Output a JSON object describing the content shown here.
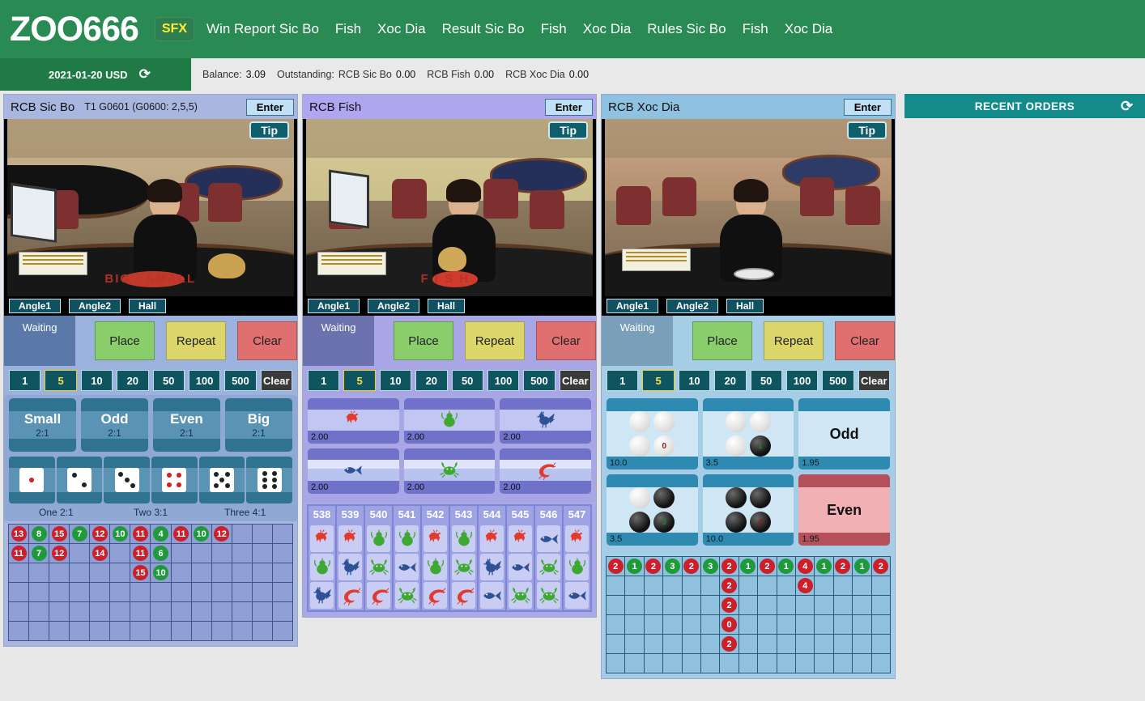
{
  "brand": "ZOO666",
  "nav": {
    "sfx": "SFX",
    "items": [
      "Win Report Sic Bo",
      "Fish",
      "Xoc Dia",
      "Result Sic Bo",
      "Fish",
      "Xoc Dia",
      "Rules Sic Bo",
      "Fish",
      "Xoc Dia"
    ]
  },
  "infobar": {
    "date": "2021-01-20 USD",
    "refresh_icon": "refresh-icon",
    "balance_label": "Balance:",
    "balance_value": "3.09",
    "outstanding_label": "Outstanding:",
    "outstanding": [
      {
        "label": "RCB Sic Bo",
        "value": "0.00"
      },
      {
        "label": "RCB Fish",
        "value": "0.00"
      },
      {
        "label": "RCB Xoc Dia",
        "value": "0.00"
      }
    ]
  },
  "common": {
    "enter": "Enter",
    "tip": "Tip",
    "angles": [
      "Angle1",
      "Angle2",
      "Hall"
    ],
    "status": "Waiting",
    "actions": {
      "place": "Place",
      "repeat": "Repeat",
      "clear": "Clear"
    },
    "chips": [
      "1",
      "5",
      "10",
      "20",
      "50",
      "100",
      "500"
    ],
    "chip_clear": "Clear",
    "chip_selected": "5"
  },
  "sicbo": {
    "title": "RCB Sic Bo",
    "round": "T1 G0601 (G0600: 2,5,5)",
    "bets": [
      {
        "name": "Small",
        "odds": "2:1"
      },
      {
        "name": "Odd",
        "odds": "2:1"
      },
      {
        "name": "Even",
        "odds": "2:1"
      },
      {
        "name": "Big",
        "odds": "2:1"
      }
    ],
    "dice": [
      {
        "pips": 1,
        "color": "red"
      },
      {
        "pips": 2,
        "color": "black"
      },
      {
        "pips": 3,
        "color": "black"
      },
      {
        "pips": 4,
        "color": "red"
      },
      {
        "pips": 5,
        "color": "black"
      },
      {
        "pips": 6,
        "color": "black"
      }
    ],
    "dice_legend": [
      "One  2:1",
      "Two  3:1",
      "Three  4:1"
    ],
    "history_cols": 14,
    "history_rows": 6,
    "history": [
      [
        {
          "v": "13",
          "c": "red"
        },
        {
          "v": "8",
          "c": "green"
        },
        {
          "v": "15",
          "c": "red"
        },
        {
          "v": "7",
          "c": "green"
        },
        {
          "v": "12",
          "c": "red"
        },
        {
          "v": "10",
          "c": "green"
        },
        {
          "v": "11",
          "c": "red"
        },
        {
          "v": "4",
          "c": "green"
        },
        {
          "v": "11",
          "c": "red"
        },
        {
          "v": "10",
          "c": "green"
        },
        {
          "v": "12",
          "c": "red"
        },
        null,
        null,
        null
      ],
      [
        {
          "v": "11",
          "c": "red"
        },
        {
          "v": "7",
          "c": "green"
        },
        {
          "v": "12",
          "c": "red"
        },
        null,
        {
          "v": "14",
          "c": "red"
        },
        null,
        {
          "v": "11",
          "c": "red"
        },
        {
          "v": "6",
          "c": "green"
        },
        null,
        null,
        null,
        null,
        null,
        null
      ],
      [
        null,
        null,
        null,
        null,
        null,
        null,
        {
          "v": "15",
          "c": "red"
        },
        {
          "v": "10",
          "c": "green"
        },
        null,
        null,
        null,
        null,
        null,
        null
      ],
      [
        null,
        null,
        null,
        null,
        null,
        null,
        null,
        null,
        null,
        null,
        null,
        null,
        null,
        null
      ],
      [
        null,
        null,
        null,
        null,
        null,
        null,
        null,
        null,
        null,
        null,
        null,
        null,
        null,
        null
      ],
      [
        null,
        null,
        null,
        null,
        null,
        null,
        null,
        null,
        null,
        null,
        null,
        null,
        null,
        null
      ]
    ]
  },
  "fish": {
    "title": "RCB Fish",
    "bets": [
      {
        "animal": "deer",
        "payout": "2.00",
        "water": false
      },
      {
        "animal": "gourd",
        "payout": "2.00",
        "water": false
      },
      {
        "animal": "rooster",
        "payout": "2.00",
        "water": false
      },
      {
        "animal": "fish",
        "payout": "2.00",
        "water": true
      },
      {
        "animal": "crab",
        "payout": "2.00",
        "water": true
      },
      {
        "animal": "shrimp",
        "payout": "2.00",
        "water": true
      }
    ],
    "history_numbers": [
      "538",
      "539",
      "540",
      "541",
      "542",
      "543",
      "544",
      "545",
      "546",
      "547"
    ],
    "history": [
      [
        "deer",
        "gourd",
        "rooster"
      ],
      [
        "deer",
        "rooster",
        "shrimp"
      ],
      [
        "gourd",
        "crab",
        "shrimp"
      ],
      [
        "gourd",
        "fish",
        "crab"
      ],
      [
        "deer",
        "gourd",
        "shrimp"
      ],
      [
        "gourd",
        "crab",
        "shrimp"
      ],
      [
        "deer",
        "rooster",
        "fish"
      ],
      [
        "deer",
        "fish",
        "crab"
      ],
      [
        "fish",
        "crab",
        "crab"
      ],
      [
        "deer",
        "gourd",
        "fish"
      ]
    ]
  },
  "xocdia": {
    "title": "RCB Xoc Dia",
    "bets": [
      {
        "kind": "beads",
        "beads": [
          "w",
          "w",
          "w",
          "w"
        ],
        "mark": "0",
        "payout": "10.0"
      },
      {
        "kind": "beads",
        "beads": [
          "w",
          "w",
          "w",
          "b"
        ],
        "mark": "1",
        "payout": "3.5"
      },
      {
        "kind": "text",
        "name": "Odd",
        "payout": "1.95",
        "red": false
      },
      {
        "kind": "beads",
        "beads": [
          "w",
          "b",
          "b",
          "b"
        ],
        "mark": "3",
        "payout": "3.5"
      },
      {
        "kind": "beads",
        "beads": [
          "b",
          "b",
          "b",
          "b"
        ],
        "mark": "4",
        "payout": "10.0"
      },
      {
        "kind": "text",
        "name": "Even",
        "payout": "1.95",
        "red": true
      }
    ],
    "history_cols": 15,
    "history_rows": 6,
    "history": [
      [
        {
          "v": "2",
          "c": "red"
        },
        {
          "v": "1",
          "c": "green"
        },
        {
          "v": "2",
          "c": "red"
        },
        {
          "v": "3",
          "c": "green"
        },
        {
          "v": "2",
          "c": "red"
        },
        {
          "v": "3",
          "c": "green"
        },
        {
          "v": "2",
          "c": "red"
        },
        {
          "v": "1",
          "c": "green"
        },
        {
          "v": "2",
          "c": "red"
        },
        {
          "v": "1",
          "c": "green"
        },
        {
          "v": "4",
          "c": "red"
        },
        {
          "v": "1",
          "c": "green"
        },
        {
          "v": "2",
          "c": "red"
        },
        {
          "v": "1",
          "c": "green"
        },
        {
          "v": "2",
          "c": "red"
        }
      ],
      [
        null,
        null,
        null,
        null,
        null,
        null,
        {
          "v": "2",
          "c": "red"
        },
        null,
        null,
        null,
        {
          "v": "4",
          "c": "red"
        },
        null,
        null,
        null,
        null
      ],
      [
        null,
        null,
        null,
        null,
        null,
        null,
        {
          "v": "2",
          "c": "red"
        },
        null,
        null,
        null,
        null,
        null,
        null,
        null,
        null
      ],
      [
        null,
        null,
        null,
        null,
        null,
        null,
        {
          "v": "0",
          "c": "red"
        },
        null,
        null,
        null,
        null,
        null,
        null,
        null,
        null
      ],
      [
        null,
        null,
        null,
        null,
        null,
        null,
        {
          "v": "2",
          "c": "red"
        },
        null,
        null,
        null,
        null,
        null,
        null,
        null,
        null
      ],
      [
        null,
        null,
        null,
        null,
        null,
        null,
        null,
        null,
        null,
        null,
        null,
        null,
        null,
        null,
        null
      ]
    ]
  },
  "orders": {
    "title": "RECENT ORDERS",
    "refresh_icon": "refresh-icon"
  }
}
